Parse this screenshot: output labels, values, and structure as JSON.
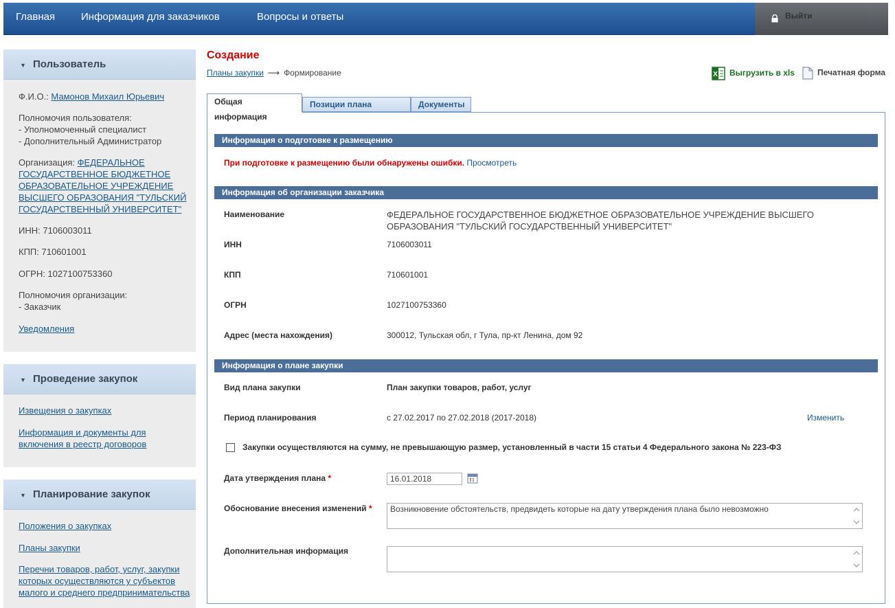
{
  "nav": {
    "home": "Главная",
    "info": "Информация для заказчиков",
    "faq": "Вопросы и ответы",
    "logout": "Выйти"
  },
  "sidebar": {
    "user": {
      "title": "Пользователь",
      "fio_label": "Ф.И.О.: ",
      "fio_value": "Мамонов Михаил Юрьевич",
      "perm_title": "Полномочия пользователя:",
      "perm_1": "- Уполномоченный специалист",
      "perm_2": "- Дополнительный Администратор",
      "org_label": "Организация: ",
      "org_line1": "ФЕДЕРАЛЬНОЕ",
      "org_line2": "ГОСУДАРСТВЕННОЕ БЮДЖЕТНОЕ",
      "org_line3": "ОБРАЗОВАТЕЛЬНОЕ УЧРЕЖДЕНИЕ",
      "org_line4": "ВЫСШЕГО ОБРАЗОВАНИЯ \"ТУЛЬСКИЙ",
      "org_line5": "ГОСУДАРСТВЕННЫЙ УНИВЕРСИТЕТ\"",
      "inn": "ИНН: 7106003011",
      "kpp": "КПП: 710601001",
      "ogrn": "ОГРН: 1027100753360",
      "org_perm_title": "Полномочия организации:",
      "org_perm_1": "- Заказчик",
      "notifications": "Уведомления"
    },
    "procurement": {
      "title": "Проведение закупок",
      "item1": "Извещения о закупках",
      "item2_l1": "Информация и документы для",
      "item2_l2": "включения в реестр договоров"
    },
    "planning": {
      "title": "Планирование закупок",
      "item1": "Положения о закупках",
      "item2": "Планы закупки",
      "item3_l1": "Перечни товаров, работ, услуг, закупки",
      "item3_l2": "которых осуществляются у субъектов",
      "item3_l3": "малого и среднего предпринимательства"
    }
  },
  "main": {
    "title": "Создание",
    "breadcrumb_link": "Планы закупки",
    "breadcrumb_sep": "⟶",
    "breadcrumb_current": "Формирование",
    "export_xls": "Выгрузить в xls",
    "print_form": "Печатная форма",
    "tabs": {
      "general": "Общая информация",
      "positions": "Позиции плана закупки",
      "documents": "Документы"
    }
  },
  "form": {
    "section_prep": "Информация о подготовке к размещению",
    "error_text": "При подготовке к размещению были обнаружены ошибки.",
    "error_link": "Просмотреть",
    "section_org": "Информация об организации заказчика",
    "name_label": "Наименование",
    "name_value_l1": "ФЕДЕРАЛЬНОЕ ГОСУДАРСТВЕННОЕ БЮДЖЕТНОЕ ОБРАЗОВАТЕЛЬНОЕ УЧРЕЖДЕНИЕ ВЫСШЕГО",
    "name_value_l2": "ОБРАЗОВАНИЯ \"ТУЛЬСКИЙ ГОСУДАРСТВЕННЫЙ УНИВЕРСИТЕТ\"",
    "inn_label": "ИНН",
    "inn_value": "7106003011",
    "kpp_label": "КПП",
    "kpp_value": "710601001",
    "ogrn_label": "ОГРН",
    "ogrn_value": "1027100753360",
    "address_label": "Адрес (места нахождения)",
    "address_value": "300012, Тульская обл, г Тула, пр-кт Ленина, дом 92",
    "section_plan": "Информация о плане закупки",
    "plan_type_label": "Вид плана закупки",
    "plan_type_value": "План закупки товаров, работ, услуг",
    "period_label": "Период планирования",
    "period_value": "с 27.02.2017 по 27.02.2018 (2017-2018)",
    "change_link": "Изменить",
    "checkbox_label": "Закупки осуществляются на сумму, не превышающую размер, установленный в части 15 статьи 4 Федерального закона № 223-ФЗ",
    "approval_date_label": "Дата утверждения плана",
    "approval_date_value": "16.01.2018",
    "required_mark": "*",
    "reason_label": "Обоснование внесения изменений",
    "reason_value": "Возникновение обстоятельств, предвидеть которые на дату утверждения плана было невозможно",
    "extra_label": "Дополнительная информация",
    "extra_value": ""
  }
}
